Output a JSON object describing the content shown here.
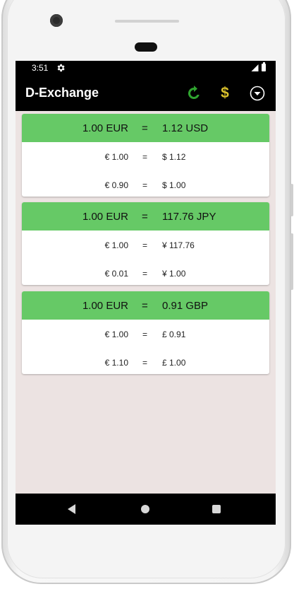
{
  "status_bar": {
    "time": "3:51"
  },
  "app_bar": {
    "title": "D-Exchange",
    "refresh_icon": "refresh-icon",
    "currency_icon_glyph": "$",
    "more_icon": "dropdown-circle-icon"
  },
  "colors": {
    "header_green": "#66c966",
    "currency_icon": "#d9c02b",
    "refresh_icon": "#2fa32f",
    "background": "#ece3e2"
  },
  "cards": [
    {
      "header": {
        "base": "1.00 EUR",
        "eq": "=",
        "target": "1.12 USD"
      },
      "rows": [
        {
          "base": "€ 1.00",
          "eq": "=",
          "target": "$ 1.12"
        },
        {
          "base": "€ 0.90",
          "eq": "=",
          "target": "$ 1.00"
        }
      ]
    },
    {
      "header": {
        "base": "1.00 EUR",
        "eq": "=",
        "target": "117.76 JPY"
      },
      "rows": [
        {
          "base": "€ 1.00",
          "eq": "=",
          "target": "¥ 117.76"
        },
        {
          "base": "€ 0.01",
          "eq": "=",
          "target": "¥ 1.00"
        }
      ]
    },
    {
      "header": {
        "base": "1.00 EUR",
        "eq": "=",
        "target": "0.91 GBP"
      },
      "rows": [
        {
          "base": "€ 1.00",
          "eq": "=",
          "target": "£ 0.91"
        },
        {
          "base": "€ 1.10",
          "eq": "=",
          "target": "£ 1.00"
        }
      ]
    }
  ]
}
